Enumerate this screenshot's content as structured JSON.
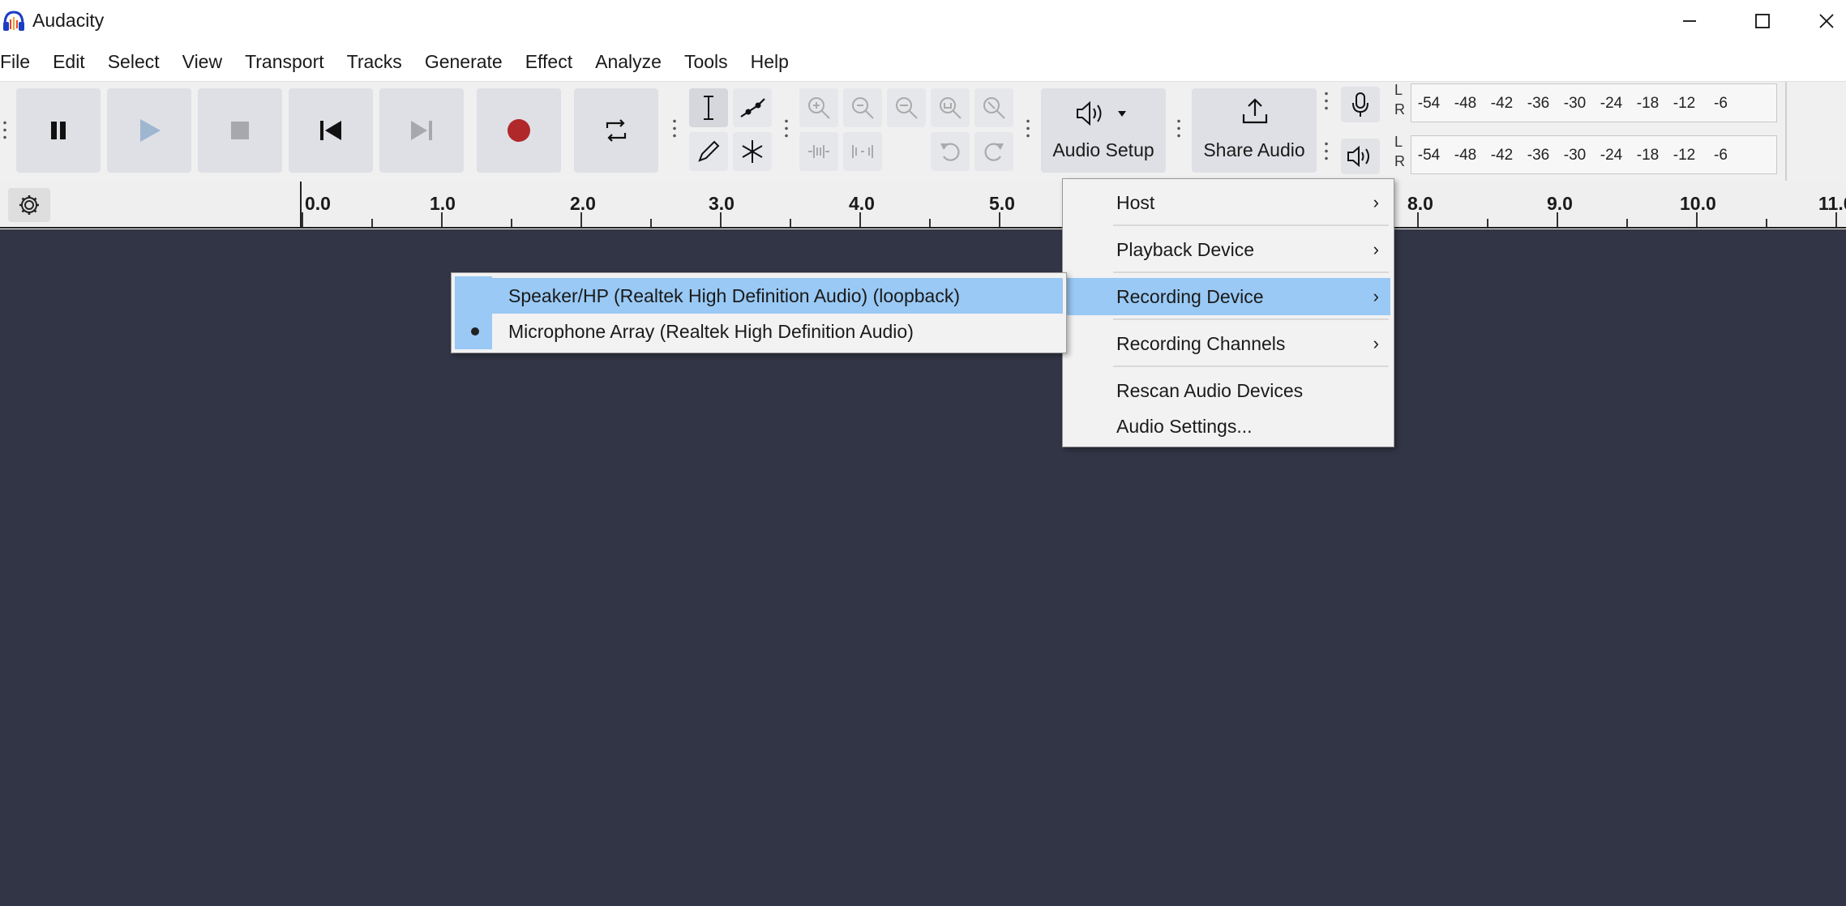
{
  "window": {
    "title": "Audacity"
  },
  "menubar": [
    "File",
    "Edit",
    "Select",
    "View",
    "Transport",
    "Tracks",
    "Generate",
    "Effect",
    "Analyze",
    "Tools",
    "Help"
  ],
  "toolbar": {
    "audio_setup_label": "Audio Setup",
    "share_audio_label": "Share Audio",
    "meter_channels": [
      "L",
      "R"
    ],
    "meter_ticks": [
      "-54",
      "-48",
      "-42",
      "-36",
      "-30",
      "-24",
      "-18",
      "-12",
      "-6"
    ]
  },
  "ruler": {
    "labels": [
      "0.0",
      "1.0",
      "2.0",
      "3.0",
      "4.0",
      "5.0",
      "8.0",
      "9.0",
      "10.0",
      "11.0"
    ]
  },
  "audio_setup_menu": {
    "items": [
      {
        "label": "Host",
        "submenu": true
      },
      {
        "label": "Playback Device",
        "submenu": true
      },
      {
        "label": "Recording Device",
        "submenu": true,
        "highlighted": true
      },
      {
        "label": "Recording Channels",
        "submenu": true
      },
      {
        "label": "Rescan Audio Devices",
        "submenu": false
      },
      {
        "label": "Audio Settings...",
        "submenu": false
      }
    ]
  },
  "recording_device_submenu": {
    "items": [
      {
        "label": "Speaker/HP (Realtek High Definition Audio) (loopback)",
        "highlighted": true,
        "selected": false
      },
      {
        "label": "Microphone Array (Realtek High Definition Audio)",
        "highlighted": false,
        "selected": true
      }
    ]
  },
  "colors": {
    "track_bg": "#323545",
    "highlight": "#99c9f4",
    "record_red": "#b0282a"
  }
}
